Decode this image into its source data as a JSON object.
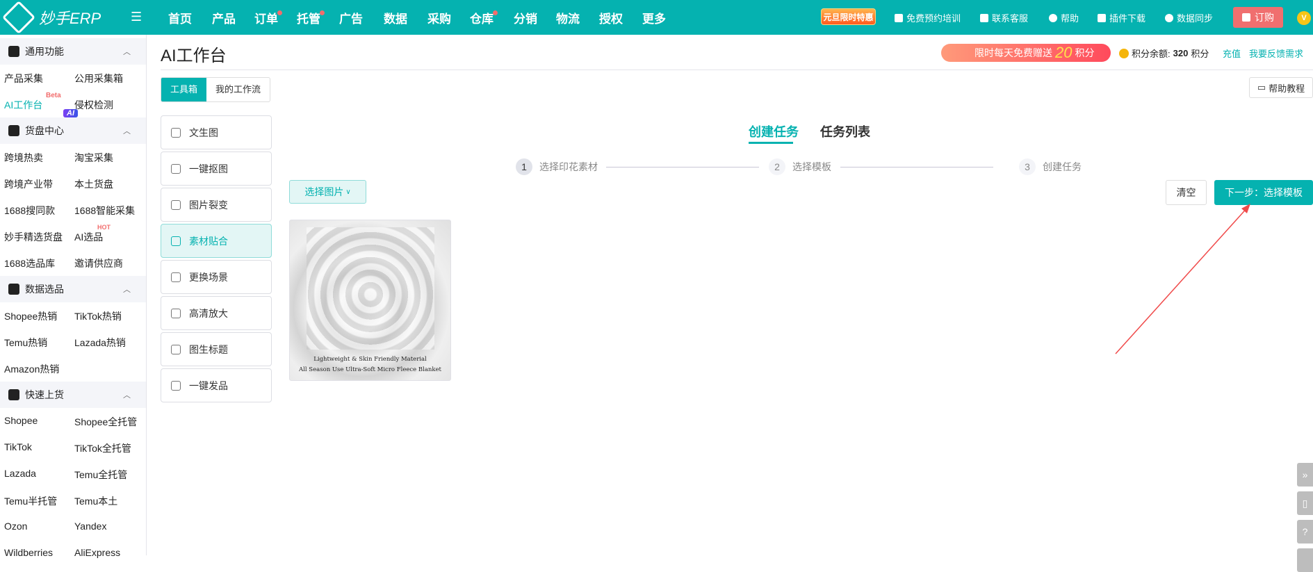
{
  "header": {
    "logo": "妙手ERP",
    "nav": [
      {
        "label": "首页",
        "dot": false
      },
      {
        "label": "产品",
        "dot": false
      },
      {
        "label": "订单",
        "dot": true
      },
      {
        "label": "托管",
        "dot": true
      },
      {
        "label": "广告",
        "dot": false
      },
      {
        "label": "数据",
        "dot": false
      },
      {
        "label": "采购",
        "dot": false
      },
      {
        "label": "仓库",
        "dot": true
      },
      {
        "label": "分销",
        "dot": false
      },
      {
        "label": "物流",
        "dot": false
      },
      {
        "label": "授权",
        "dot": false
      },
      {
        "label": "更多",
        "dot": false
      }
    ],
    "promo": "元旦限时特惠",
    "links": [
      "免费预约培训",
      "联系客服",
      "帮助",
      "插件下载",
      "数据同步"
    ],
    "order": "订购",
    "avatar": "V"
  },
  "sidebar": {
    "groups": [
      {
        "title": "通用功能",
        "items": [
          "产品采集",
          "公用采集箱",
          "AI工作台",
          "侵权检测"
        ]
      },
      {
        "title": "货盘中心",
        "badge": "AI",
        "items": [
          "跨境热卖",
          "淘宝采集",
          "跨境产业带",
          "本土货盘",
          "1688搜同款",
          "1688智能采集",
          "妙手精选货盘",
          "AI选品",
          "1688选品库",
          "邀请供应商"
        ]
      },
      {
        "title": "数据选品",
        "items": [
          "Shopee热销",
          "TikTok热销",
          "Temu热销",
          "Lazada热销",
          "Amazon热销"
        ]
      },
      {
        "title": "快速上货",
        "items": [
          "Shopee",
          "Shopee全托管",
          "TikTok",
          "TikTok全托管",
          "Lazada",
          "Temu全托管",
          "Temu半托管",
          "Temu本土",
          "Ozon",
          "Yandex",
          "Wildberries",
          "AliExpress"
        ]
      }
    ],
    "beta": "Beta",
    "hot": "HOT"
  },
  "page": {
    "title": "AI工作台",
    "banner_text": "限时每天免费赠送",
    "banner_num": "20",
    "banner_unit": "积分",
    "points_label": "积分余额:",
    "points": "320",
    "points_unit": "积分",
    "recharge": "充值",
    "feedback": "我要反馈需求",
    "help": "帮助教程",
    "seg": [
      "工具箱",
      "我的工作流"
    ],
    "tools": [
      "文生图",
      "一键抠图",
      "图片裂变",
      "素材贴合",
      "更换场景",
      "高清放大",
      "图生标题",
      "一键发品"
    ],
    "ctabs": [
      "创建任务",
      "任务列表"
    ],
    "steps": [
      {
        "n": "1",
        "label": "选择印花素材"
      },
      {
        "n": "2",
        "label": "选择模板"
      },
      {
        "n": "3",
        "label": "创建任务"
      }
    ],
    "select_image": "选择图片",
    "clear": "清空",
    "next": "下一步：选择模板",
    "image_caption": [
      "Lightweight & Skin Friendly Material",
      "All Season Use Ultra-Soft Micro Fleece Blanket"
    ]
  },
  "colors": {
    "brand": "#05b2b0",
    "accent_red": "#f06f6f"
  }
}
